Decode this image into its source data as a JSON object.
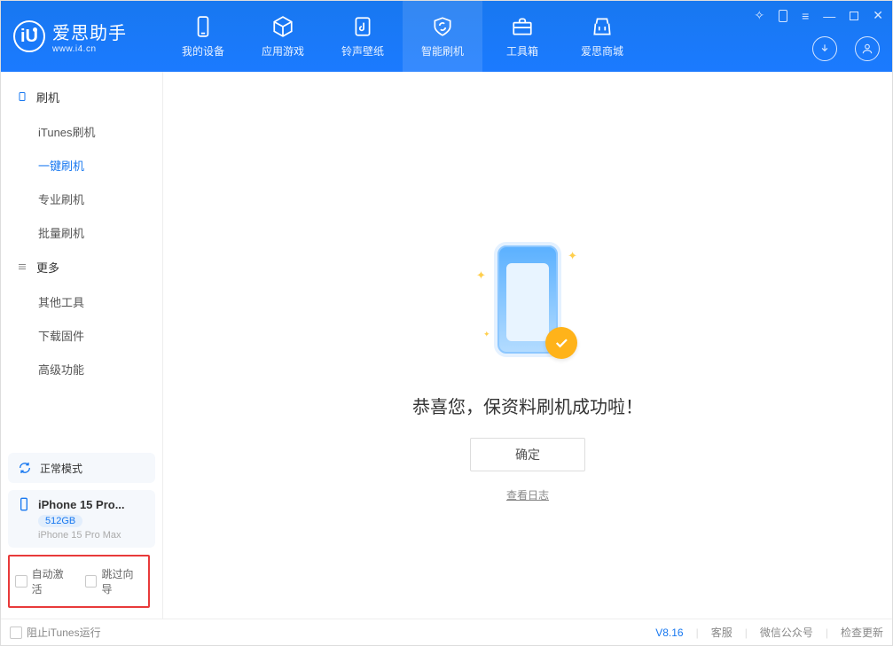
{
  "app": {
    "title": "爱思助手",
    "subtitle": "www.i4.cn"
  },
  "tabs": {
    "device": "我的设备",
    "apps": "应用游戏",
    "ringtone": "铃声壁纸",
    "flash": "智能刷机",
    "toolbox": "工具箱",
    "store": "爱思商城"
  },
  "sidebar": {
    "group1_title": "刷机",
    "items1": {
      "itunes": "iTunes刷机",
      "oneclick": "一键刷机",
      "pro": "专业刷机",
      "batch": "批量刷机"
    },
    "group2_title": "更多",
    "items2": {
      "other": "其他工具",
      "download": "下载固件",
      "advanced": "高级功能"
    }
  },
  "mode": {
    "label": "正常模式"
  },
  "device": {
    "name": "iPhone 15 Pro...",
    "capacity": "512GB",
    "model": "iPhone 15 Pro Max"
  },
  "options": {
    "auto_activate": "自动激活",
    "skip_guide": "跳过向导"
  },
  "main": {
    "success": "恭喜您，保资料刷机成功啦！",
    "ok": "确定",
    "view_log": "查看日志"
  },
  "status": {
    "block_itunes": "阻止iTunes运行",
    "version": "V8.16",
    "support": "客服",
    "wechat": "微信公众号",
    "update": "检查更新"
  }
}
